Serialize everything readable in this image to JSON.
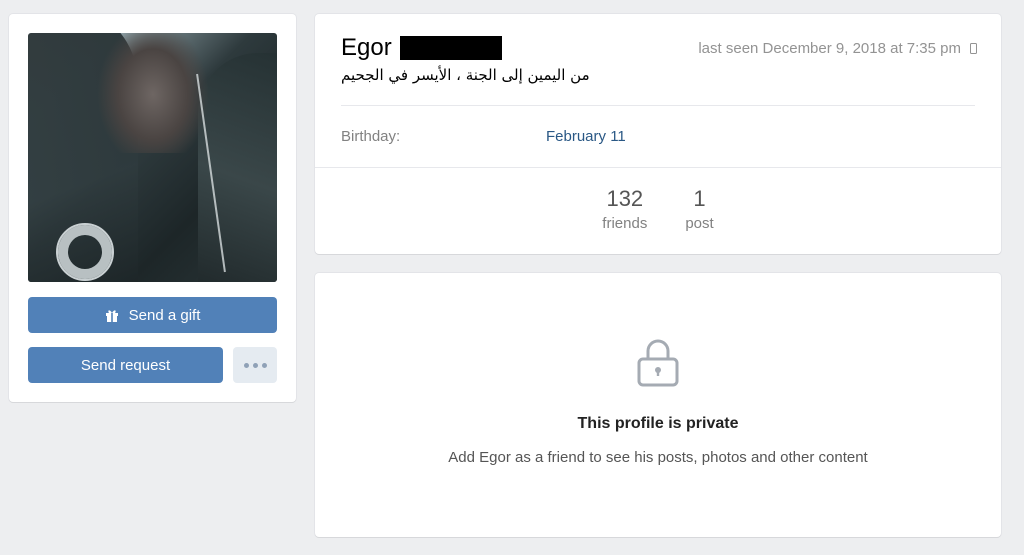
{
  "profile": {
    "first_name": "Egor",
    "last_seen": "last seen December 9, 2018 at 7:35 pm",
    "status": "من اليمين إلى الجنة ، الأيسر في الجحيم",
    "birthday_label": "Birthday:",
    "birthday_value": "February 11"
  },
  "actions": {
    "gift_label": "Send a gift",
    "request_label": "Send request"
  },
  "counters": [
    {
      "value": "132",
      "label": "friends"
    },
    {
      "value": "1",
      "label": "post"
    }
  ],
  "private": {
    "title": "This profile is private",
    "subtitle": "Add Egor as a friend to see his posts, photos and other content"
  },
  "colors": {
    "background": "#edeef0",
    "button": "#5181b8",
    "link": "#2a5885",
    "muted": "#828282"
  },
  "icons": [
    "gift-icon",
    "more-icon",
    "mobile-icon",
    "lock-icon"
  ]
}
